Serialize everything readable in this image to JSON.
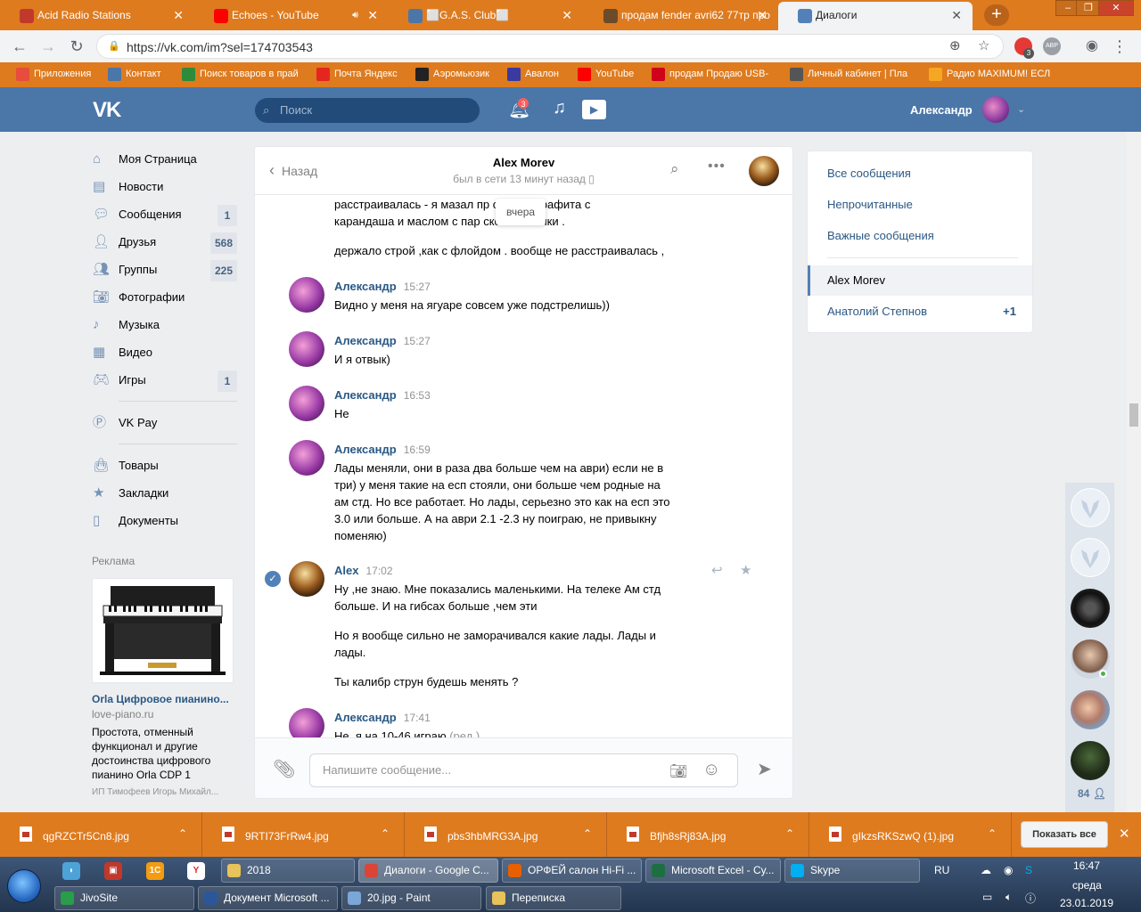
{
  "browser": {
    "tabs": [
      {
        "title": "Acid Radio Stations",
        "icon": "acid-radio-icon",
        "color": "#c0392b",
        "active": false
      },
      {
        "title": "Echoes - YouTube",
        "icon": "youtube-icon",
        "color": "#ff0000",
        "active": false
      },
      {
        "title": "⬜G.A.S. Club⬜",
        "icon": "vk-icon",
        "color": "#4a76a8",
        "active": false
      },
      {
        "title": "продам fender avri62 77тр про",
        "icon": "guitar-icon",
        "color": "#6b4b2a",
        "active": false
      },
      {
        "title": "Диалоги",
        "icon": "vk-messages-icon",
        "color": "#5181b8",
        "active": true
      }
    ],
    "url": "https://vk.com/im?sel=174703543",
    "extension_badge": "3",
    "extension_label": "АВР",
    "bookmarks": [
      {
        "label": "Приложения",
        "icon": "apps-grid-icon",
        "color": "#e74c3c"
      },
      {
        "label": "Контакт",
        "icon": "vk-icon",
        "color": "#4a76a8"
      },
      {
        "label": "Поиск товаров в прай",
        "icon": "leaf-icon",
        "color": "#2e8b3a"
      },
      {
        "label": "Почта Яндекс",
        "icon": "yandex-icon",
        "color": "#e52620"
      },
      {
        "label": "Аэромьюзик",
        "icon": "aeromusic-icon",
        "color": "#222222"
      },
      {
        "label": "Авалон",
        "icon": "avalon-icon",
        "color": "#3a3aa0"
      },
      {
        "label": "YouTube",
        "icon": "youtube-icon",
        "color": "#ff0000"
      },
      {
        "label": "продам Продаю USB-",
        "icon": "mf-icon",
        "color": "#d0021b"
      },
      {
        "label": "Личный кабинет | Пла",
        "icon": "arrow-icon",
        "color": "#555555"
      },
      {
        "label": "Радио MAXIMUM! ЕСЛ",
        "icon": "bolt-icon",
        "color": "#f5a623"
      }
    ]
  },
  "vk": {
    "logo": "VK",
    "search_placeholder": "Поиск",
    "notifications_count": "3",
    "user_name": "Александр",
    "nav": [
      {
        "label": "Моя Страница",
        "icon": "home-icon",
        "count": ""
      },
      {
        "label": "Новости",
        "icon": "news-icon",
        "count": ""
      },
      {
        "label": "Сообщения",
        "icon": "messages-icon",
        "count": "1"
      },
      {
        "label": "Друзья",
        "icon": "friends-icon",
        "count": "568"
      },
      {
        "label": "Группы",
        "icon": "groups-icon",
        "count": "225"
      },
      {
        "label": "Фотографии",
        "icon": "camera-icon",
        "count": ""
      },
      {
        "label": "Музыка",
        "icon": "music-icon",
        "count": ""
      },
      {
        "label": "Видео",
        "icon": "video-icon",
        "count": ""
      },
      {
        "label": "Игры",
        "icon": "games-icon",
        "count": "1"
      }
    ],
    "nav_extra": [
      {
        "label": "VK Pay",
        "icon": "vkpay-icon"
      }
    ],
    "nav_more": [
      {
        "label": "Товары",
        "icon": "bag-icon"
      },
      {
        "label": "Закладки",
        "icon": "star-icon"
      },
      {
        "label": "Документы",
        "icon": "document-icon"
      }
    ],
    "ads": {
      "title": "Реклама",
      "name": "Orla Цифровое пианино...",
      "domain": "love-piano.ru",
      "text": "Простота, отменный функционал и другие достоинства цифрового пианино Orla CDP 1",
      "owner": "ИП Тимофеев Игорь Михайл..."
    }
  },
  "chat": {
    "back_label": "Назад",
    "name": "Alex Morev",
    "status": "был в сети 13 минут назад",
    "date_pill": "вчера",
    "top_lines": [
      "расстраивалась - я мазал пр     смесью графита с",
      "карандаша и маслом с пар         ской машинки .",
      "держало строй ,как с флойдом . вообще не расстраивалась ,"
    ],
    "messages": [
      {
        "author": "Александр",
        "time": "15:27",
        "lines": [
          "Видно у меня на ягуаре совсем уже подстрелишь))"
        ]
      },
      {
        "author": "Александр",
        "time": "15:27",
        "lines": [
          "И я отвык)"
        ]
      },
      {
        "author": "Александр",
        "time": "16:53",
        "lines": [
          "Не"
        ]
      },
      {
        "author": "Александр",
        "time": "16:59",
        "lines": [
          "Лады меняли, они в раза два больше чем на аври) если не в",
          "три) у меня такие на есп стояли, они больше чем родные на",
          "ам стд. Но все работает. Но лады, серьезно это как на есп это",
          "3.0 или больше. А на аври 2.1 -2.3 ну поиграю, не привыкну",
          "поменяю)"
        ]
      },
      {
        "author": "Alex",
        "time": "17:02",
        "lines": [
          "Ну ,не знаю. Мне показались маленькими. На телеке Ам стд",
          "больше. И на гибсах больше ,чем эти"
        ],
        "lines2": [
          "Но я вообще сильно не заморачивался какие лады. Лады и",
          "лады."
        ],
        "lines3": [
          "Ты калибр струн будешь менять ?"
        ]
      },
      {
        "author": "Александр",
        "time": "17:41",
        "lines": [
          "Не, я на 10-46 играю"
        ],
        "edited": "(ред.)"
      }
    ],
    "input_placeholder": "Напишите сообщение..."
  },
  "right_panel": {
    "items": [
      "Все сообщения",
      "Непрочитанные",
      "Важные сообщения"
    ],
    "dialogs": [
      {
        "name": "Alex Morev",
        "count": ""
      },
      {
        "name": "Анатолий Степнов",
        "count": "+1"
      }
    ]
  },
  "friends_sidebar": {
    "count": "84"
  },
  "downloads": {
    "files": [
      "qgRZCTr5Cn8.jpg",
      "9RTI73FrRw4.jpg",
      "pbs3hbMRG3A.jpg",
      "Bfjh8sRj83A.jpg",
      "gIkzsRKSzwQ (1).jpg"
    ],
    "show_all": "Показать все"
  },
  "taskbar": {
    "row1": [
      {
        "label": "2018",
        "color": "#e8c25a"
      },
      {
        "label": "Диалоги - Google C...",
        "color": "#db4437",
        "active": true
      },
      {
        "label": "ОРФЕЙ салон Hi-Fi ...",
        "color": "#e66000"
      },
      {
        "label": "Microsoft Excel - Су...",
        "color": "#1d6f42"
      },
      {
        "label": "Skype",
        "color": "#00aff0"
      }
    ],
    "row2": [
      {
        "label": "JivoSite",
        "color": "#2a9d4a"
      },
      {
        "label": "Документ Microsoft ...",
        "color": "#2b579a"
      },
      {
        "label": "20.jpg - Paint",
        "color": "#7aa7d8"
      },
      {
        "label": "Переписка",
        "color": "#e8c25a"
      }
    ],
    "language": "RU",
    "time": "16:47",
    "day": "среда",
    "date": "23.01.2019"
  }
}
